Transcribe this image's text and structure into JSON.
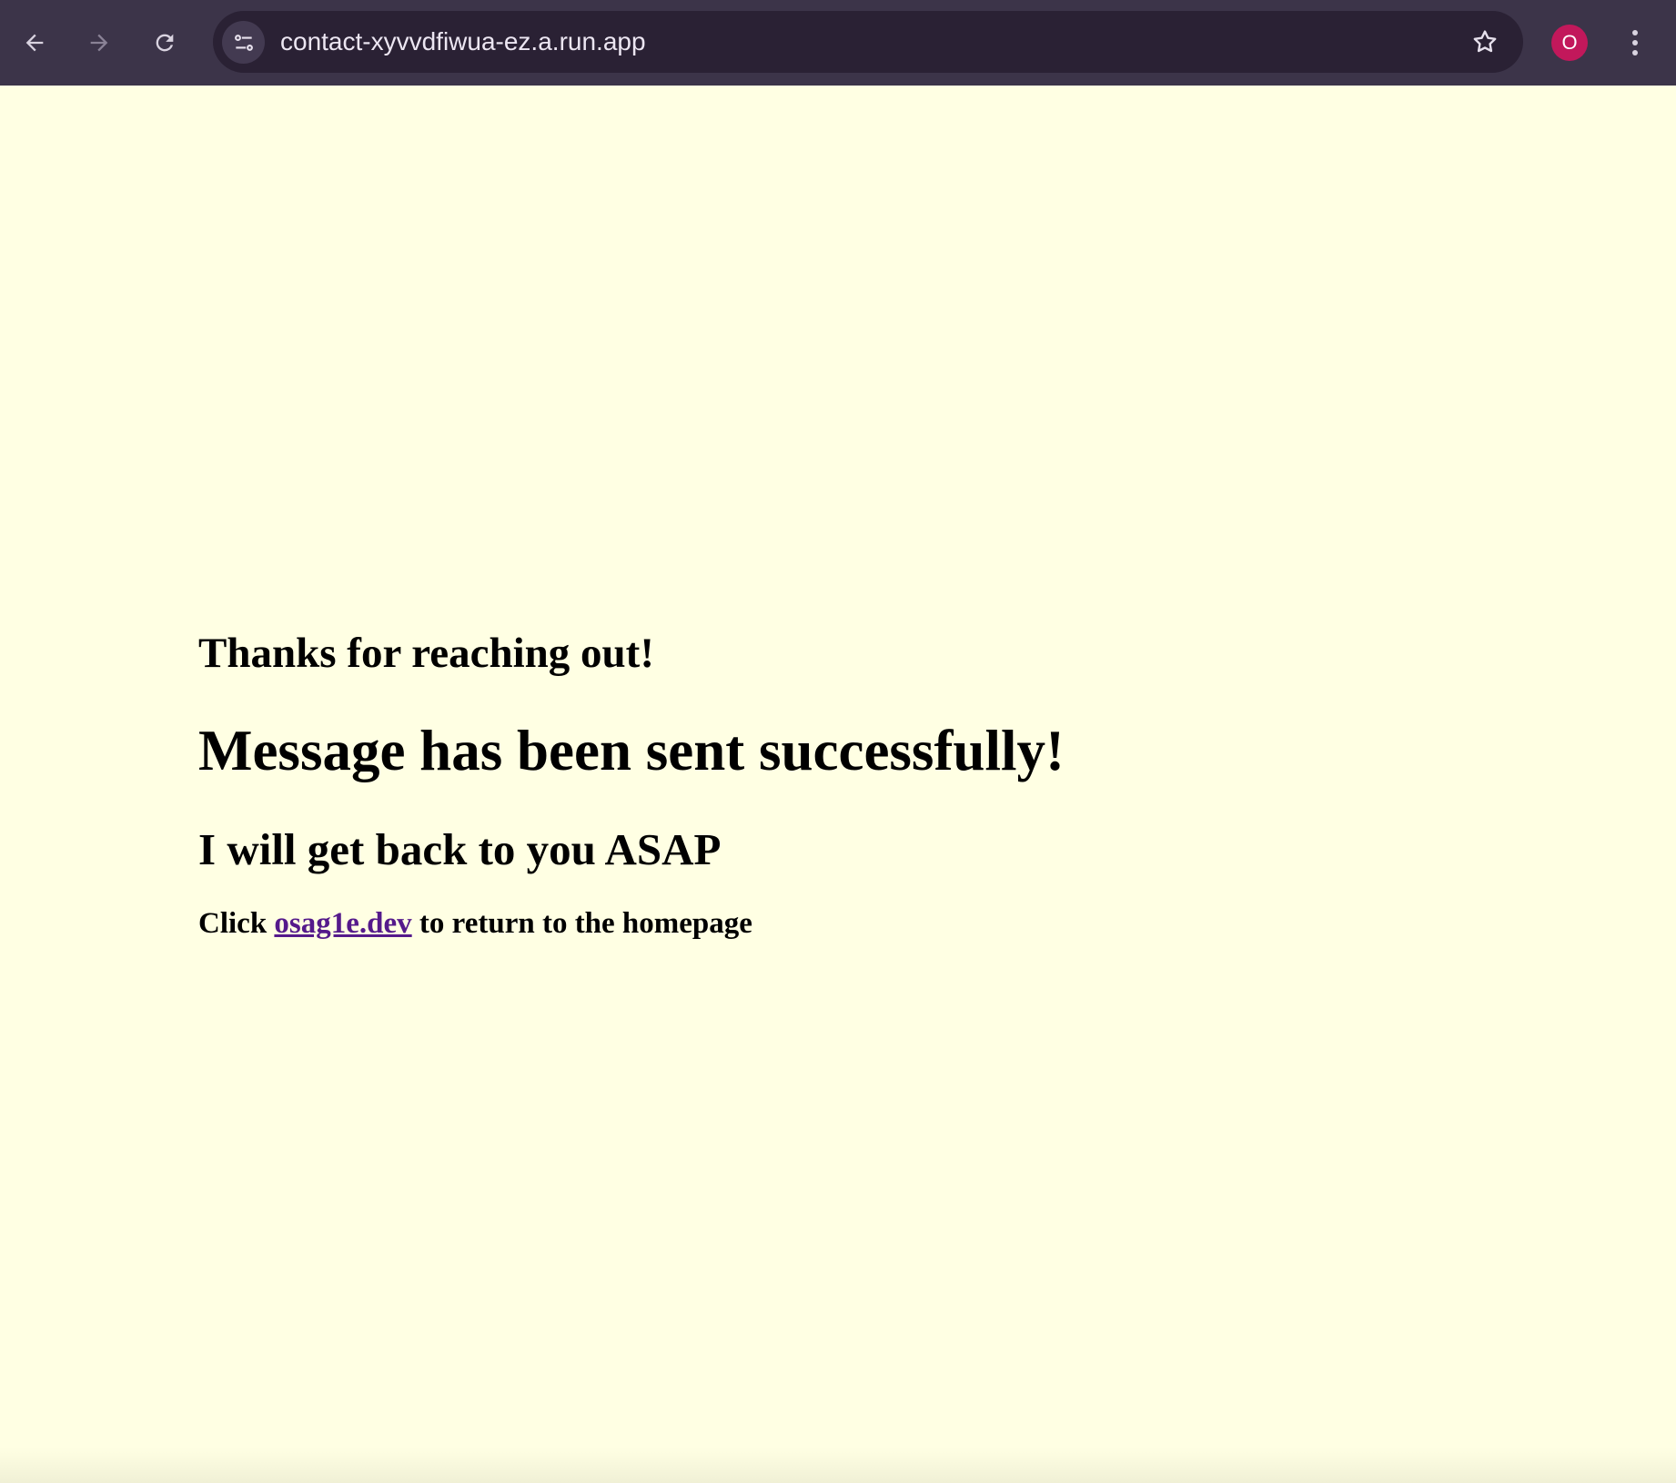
{
  "browser": {
    "url": "contact-xyvvdfiwua-ez.a.run.app",
    "profile_initial": "O",
    "colors": {
      "toolbar_bg": "#3c3449",
      "omnibox_bg": "#2a2134",
      "avatar_bg": "#c2185b",
      "page_bg": "#ffffe3",
      "link": "#551a8b"
    },
    "icons": [
      "back-arrow-icon",
      "forward-arrow-icon",
      "reload-icon",
      "site-info-icon",
      "bookmark-star-icon",
      "more-vert-icon"
    ]
  },
  "page": {
    "thanks_heading": "Thanks for reaching out!",
    "success_heading": "Message has been sent successfully!",
    "followup_heading": "I will get back to you ASAP",
    "return_prefix": "Click",
    "return_link_text": "osag1e.dev",
    "return_suffix": "to return to the homepage"
  }
}
